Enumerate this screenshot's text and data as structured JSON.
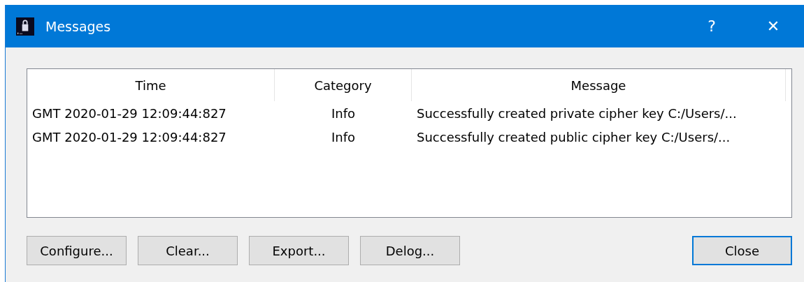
{
  "window": {
    "title": "Messages",
    "help": "?",
    "close": "✕"
  },
  "table": {
    "columns": [
      "Time",
      "Category",
      "Message"
    ],
    "rows": [
      [
        "GMT 2020-01-29 12:09:44:827",
        "Info",
        "Successfully created private cipher key C:/Users/..."
      ],
      [
        "GMT 2020-01-29 12:09:44:827",
        "Info",
        "Successfully created public cipher key C:/Users/..."
      ]
    ]
  },
  "buttons": [
    {
      "label": "Configure...",
      "default": false
    },
    {
      "label": "Clear...",
      "default": false
    },
    {
      "label": "Export...",
      "default": false
    },
    {
      "label": "Delog...",
      "default": false
    }
  ],
  "close_button": {
    "label": "Close",
    "default": true
  }
}
